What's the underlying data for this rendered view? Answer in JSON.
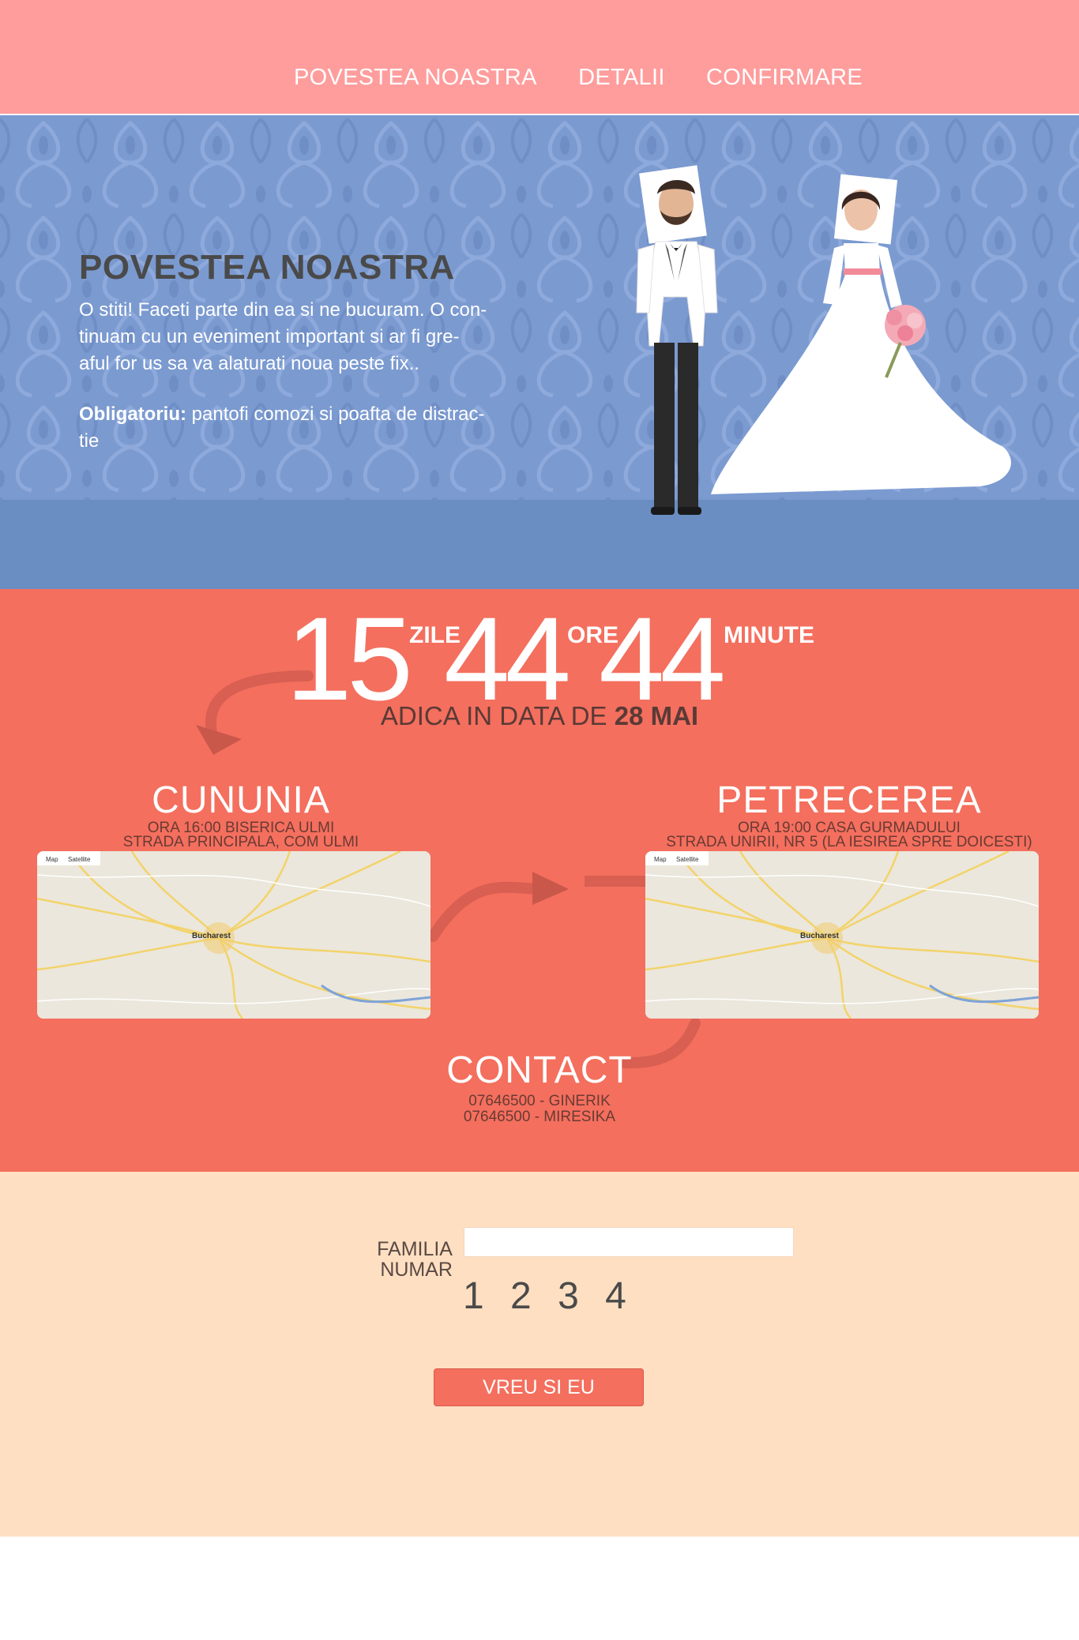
{
  "nav": {
    "items": [
      "POVESTEA NOASTRA",
      "DETALII",
      "CONFIRMARE"
    ]
  },
  "hero": {
    "title": "POVESTEA NOASTRA",
    "text_lines": [
      "O stiti! Faceti parte din ea si ne bucuram. O con-",
      "tinuam cu un eveniment important si ar fi gre-",
      "aful for us sa va alaturati noua peste fix.."
    ],
    "required_label": "Obligatoriu:",
    "required_text_lines": [
      " pantofi comozi si poafta de distrac-",
      "tie"
    ]
  },
  "countdown": {
    "days": "15",
    "days_label": "ZILE",
    "hours": "44",
    "hours_label": "ORE",
    "minutes": "44",
    "minutes_label": "MINUTE",
    "date_prefix": "ADICA IN DATA DE ",
    "date_value": "28 MAI"
  },
  "ceremony": {
    "title": "CUNUNIA",
    "line1": "ORA 16:00 BISERICA ULMI",
    "line2": "STRADA PRINCIPALA, COM  ULMI"
  },
  "party": {
    "title": "PETRECEREA",
    "line1": "ORA 19:00 CASA GURMADULUI",
    "line2": "STRADA UNIRII, NR 5 (LA IESIREA SPRE DOICESTI)"
  },
  "map": {
    "tab_map": "Map",
    "tab_satellite": "Satellite",
    "city": "Bucharest"
  },
  "contact": {
    "title": "CONTACT",
    "line1": "07646500 - GINERIK",
    "line2": "07646500 - MIRESIKA"
  },
  "form": {
    "family_label": "FAMILIA",
    "number_label": "NUMAR",
    "family_value": "",
    "numbers": [
      "1",
      "2",
      "3",
      "4"
    ],
    "submit_label": "VREU SI EU"
  },
  "colors": {
    "nav_bg": "#ff9d9d",
    "hero_bg": "#6a8dc2",
    "events_bg": "#f46f5e",
    "form_bg": "#ffdfc1"
  }
}
